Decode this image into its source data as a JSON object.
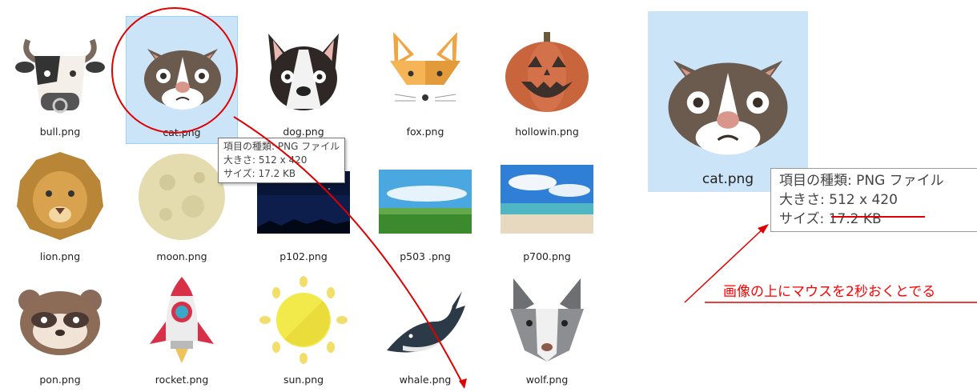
{
  "files": [
    {
      "name": "bull.png",
      "icon": "bull-icon"
    },
    {
      "name": "cat.png",
      "icon": "cat-icon",
      "selected": true
    },
    {
      "name": "dog.png",
      "icon": "dog-icon"
    },
    {
      "name": "fox.png",
      "icon": "fox-icon"
    },
    {
      "name": "hollowin.png",
      "icon": "pumpkin-icon"
    },
    {
      "name": "lion.png",
      "icon": "lion-icon"
    },
    {
      "name": "moon.png",
      "icon": "moon-icon"
    },
    {
      "name": "p102.png",
      "icon": "night-sky-photo"
    },
    {
      "name": "p503 .png",
      "icon": "field-sky-photo"
    },
    {
      "name": "p700.png",
      "icon": "beach-photo"
    },
    {
      "name": "pon.png",
      "icon": "raccoon-dog-icon"
    },
    {
      "name": "rocket.png",
      "icon": "rocket-icon"
    },
    {
      "name": "sun.png",
      "icon": "sun-icon"
    },
    {
      "name": "whale.png",
      "icon": "whale-icon"
    },
    {
      "name": "wolf.png",
      "icon": "wolf-icon"
    }
  ],
  "tooltip": {
    "type": "項目の種類: PNG ファイル",
    "dimensions": "大きさ: 512 x 420",
    "size": "サイズ: 17.2 KB"
  },
  "zoom_preview": {
    "label": "cat.png",
    "type": "項目の種類: PNG ファイル",
    "dimensions": "大きさ: 512 x 420",
    "size": "サイズ: 17.2 KB"
  },
  "annotation": {
    "text": "画像の上にマウスを2秒おくとでる",
    "color": "#ff0000"
  }
}
